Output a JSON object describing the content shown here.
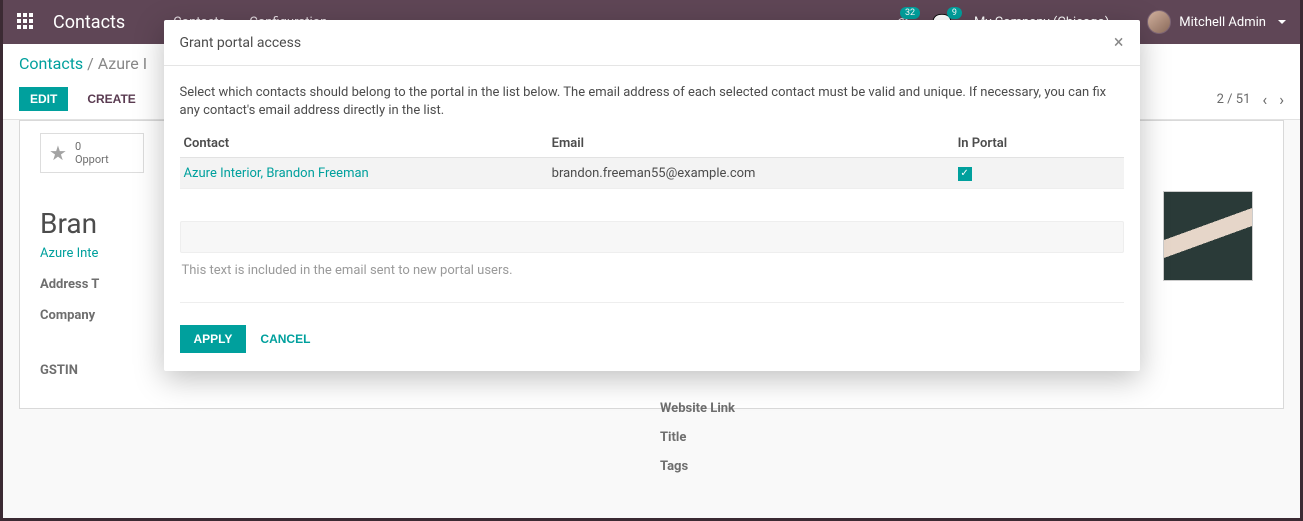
{
  "topbar": {
    "app_title": "Contacts",
    "nav": {
      "contacts": "Contacts",
      "configuration": "Configuration"
    },
    "badge1": "32",
    "badge2": "9",
    "company": "My Company (Chicago)",
    "user": "Mitchell Admin"
  },
  "breadcrumb": {
    "root": "Contacts",
    "sep": "/",
    "current": "Azure I"
  },
  "buttons": {
    "edit": "EDIT",
    "create": "CREATE"
  },
  "pager": {
    "pos": "2 / 51"
  },
  "sheet": {
    "opps_count": "0",
    "opps_label": "Opport",
    "name": "Bran",
    "company": "Azure Inte",
    "labels": {
      "address": "Address T",
      "company": "Company",
      "gstin": "GSTIN",
      "website": "Website Link",
      "title": "Title",
      "tags": "Tags"
    }
  },
  "modal": {
    "title": "Grant portal access",
    "desc": "Select which contacts should belong to the portal in the list below. The email address of each selected contact must be valid and unique. If necessary, you can fix any contact's email address directly in the list.",
    "cols": {
      "contact": "Contact",
      "email": "Email",
      "inportal": "In Portal"
    },
    "rows": [
      {
        "contact": "Azure Interior, Brandon Freeman",
        "email": "brandon.freeman55@example.com",
        "in_portal": true
      }
    ],
    "msg_placeholder": "This text is included in the email sent to new portal users.",
    "apply": "APPLY",
    "cancel": "CANCEL"
  }
}
